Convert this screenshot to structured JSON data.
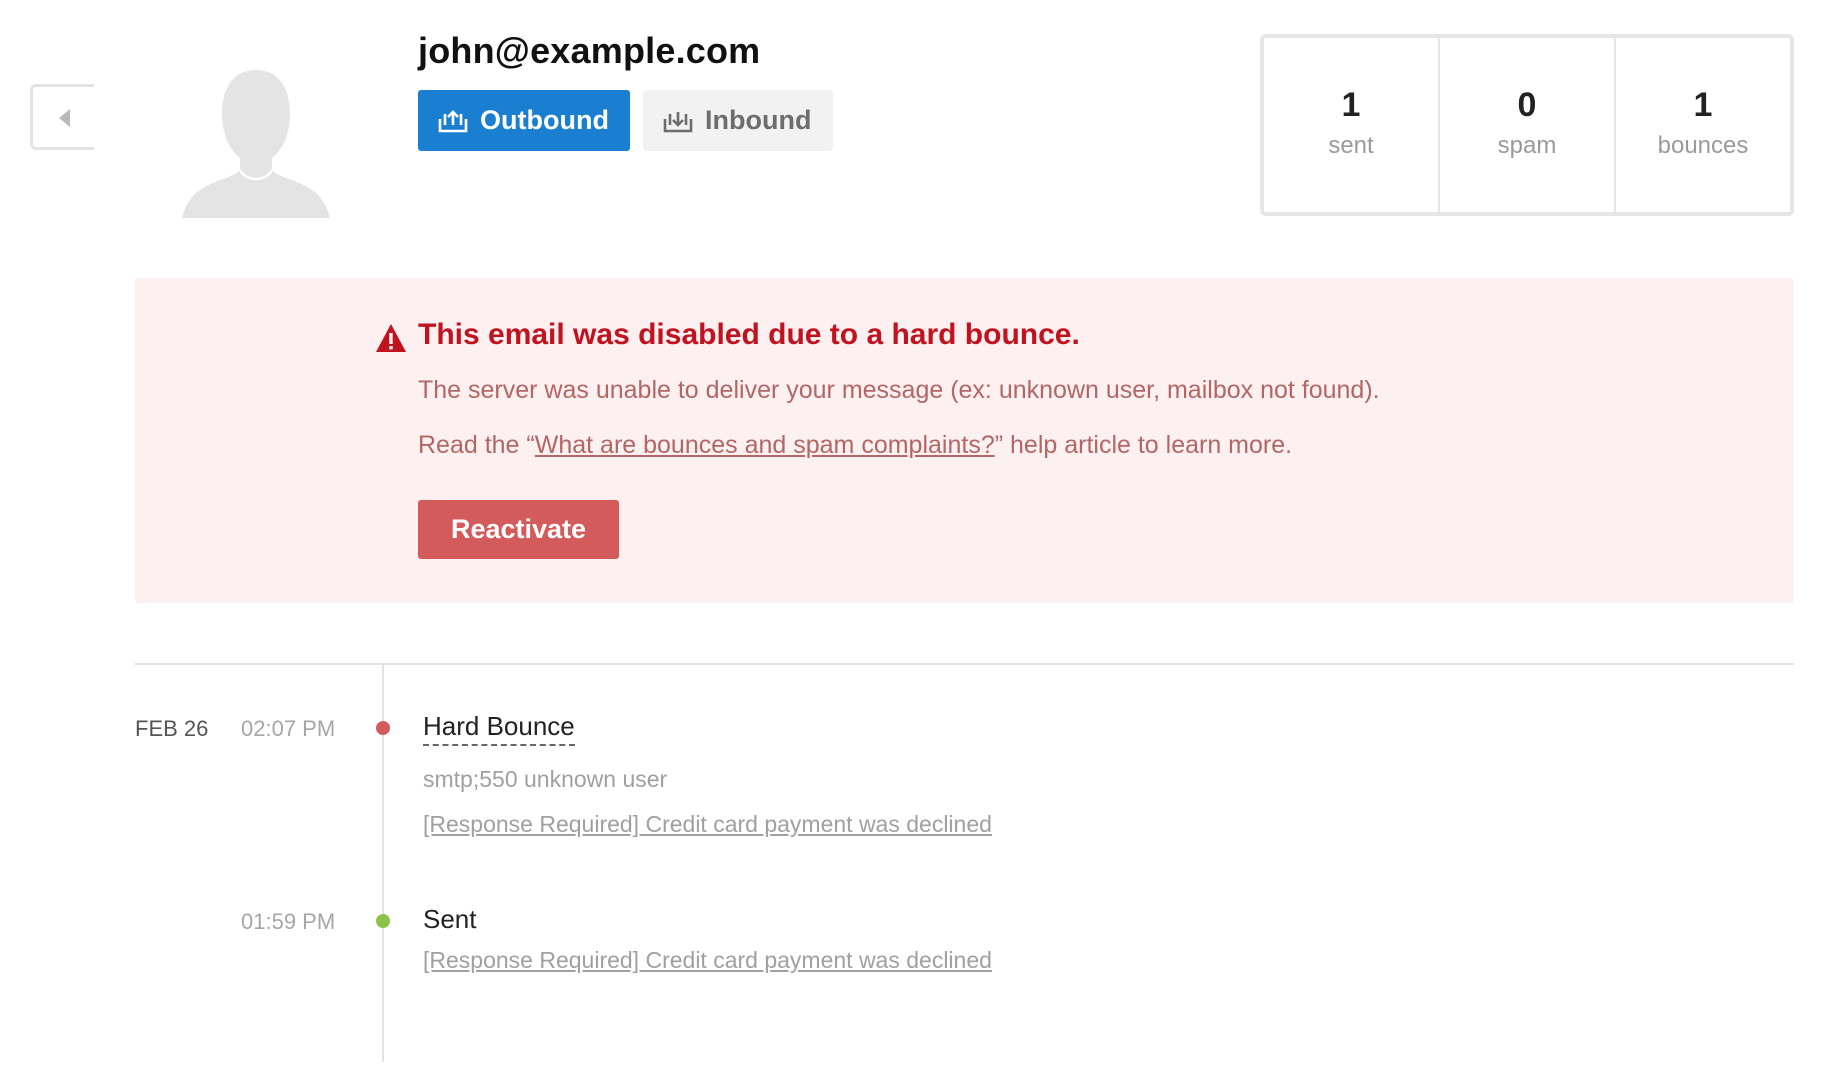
{
  "header": {
    "email": "john@example.com",
    "tabs": [
      {
        "label": "Outbound",
        "icon": "outbound-icon",
        "active": true
      },
      {
        "label": "Inbound",
        "icon": "inbound-icon",
        "active": false
      }
    ]
  },
  "stats": [
    {
      "value": "1",
      "label": "sent"
    },
    {
      "value": "0",
      "label": "spam"
    },
    {
      "value": "1",
      "label": "bounces"
    }
  ],
  "alert": {
    "title": "This email was disabled due to a hard bounce.",
    "description": "The server was unable to deliver your message (ex: unknown user, mailbox not found).",
    "help_prefix": "Read the “",
    "help_link": "What are bounces and spam complaints?",
    "help_suffix": "” help article to learn more.",
    "button_label": "Reactivate"
  },
  "timeline": {
    "events": [
      {
        "date": "FEB 26",
        "time": "02:07 PM",
        "title": "Hard Bounce",
        "detail": "smtp;550 unknown user",
        "subject": "[Response Required] Credit card payment was declined",
        "status": "bounce"
      },
      {
        "date": "",
        "time": "01:59 PM",
        "title": "Sent",
        "detail": "",
        "subject": "[Response Required] Credit card payment was declined",
        "status": "sent"
      }
    ]
  },
  "colors": {
    "primary": "#1a7fd1",
    "danger": "#c1121f",
    "danger_button": "#d35b5b",
    "alert_bg": "#fcf0f1",
    "success": "#8bc34a"
  }
}
